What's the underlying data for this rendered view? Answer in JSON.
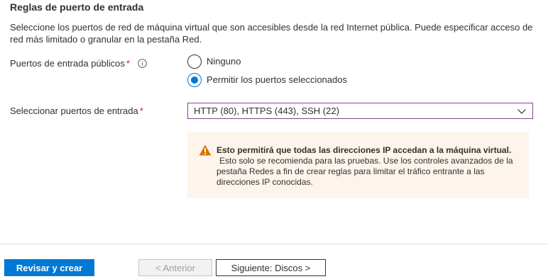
{
  "section": {
    "title": "Reglas de puerto de entrada",
    "description": "Seleccione los puertos de red de máquina virtual que son accesibles desde la red Internet pública. Puede especificar acceso de red más limitado o granular en la pestaña Red."
  },
  "public_ports": {
    "label": "Puertos de entrada públicos",
    "required_mark": "*",
    "info_icon": "info-icon",
    "options": [
      {
        "label": "Ninguno",
        "checked": false
      },
      {
        "label": "Permitir los puertos seleccionados",
        "checked": true
      }
    ]
  },
  "select_ports": {
    "label": "Seleccionar puertos de entrada",
    "required_mark": "*",
    "value": "HTTP (80), HTTPS (443), SSH (22)",
    "icon": "chevron-down-icon"
  },
  "warning": {
    "icon": "warning-icon",
    "title": "Esto permitirá que todas las direcciones IP accedan a la máquina virtual.",
    "body_lines": [
      "Esto solo se recomienda para las pruebas.  Use los controles avanzados de la",
      "pestaña Redes a fin de crear reglas para limitar el tráfico entrante a las",
      "direcciones IP conocidas."
    ]
  },
  "footer": {
    "review_create": "Revisar y crear",
    "previous": "< Anterior",
    "next": "Siguiente: Discos >"
  },
  "colors": {
    "accent": "#0078d4",
    "required": "#a4262c",
    "focus_border": "#8a3d95",
    "warning_bg": "#fdf4ec",
    "warning_icon": "#d47500"
  }
}
